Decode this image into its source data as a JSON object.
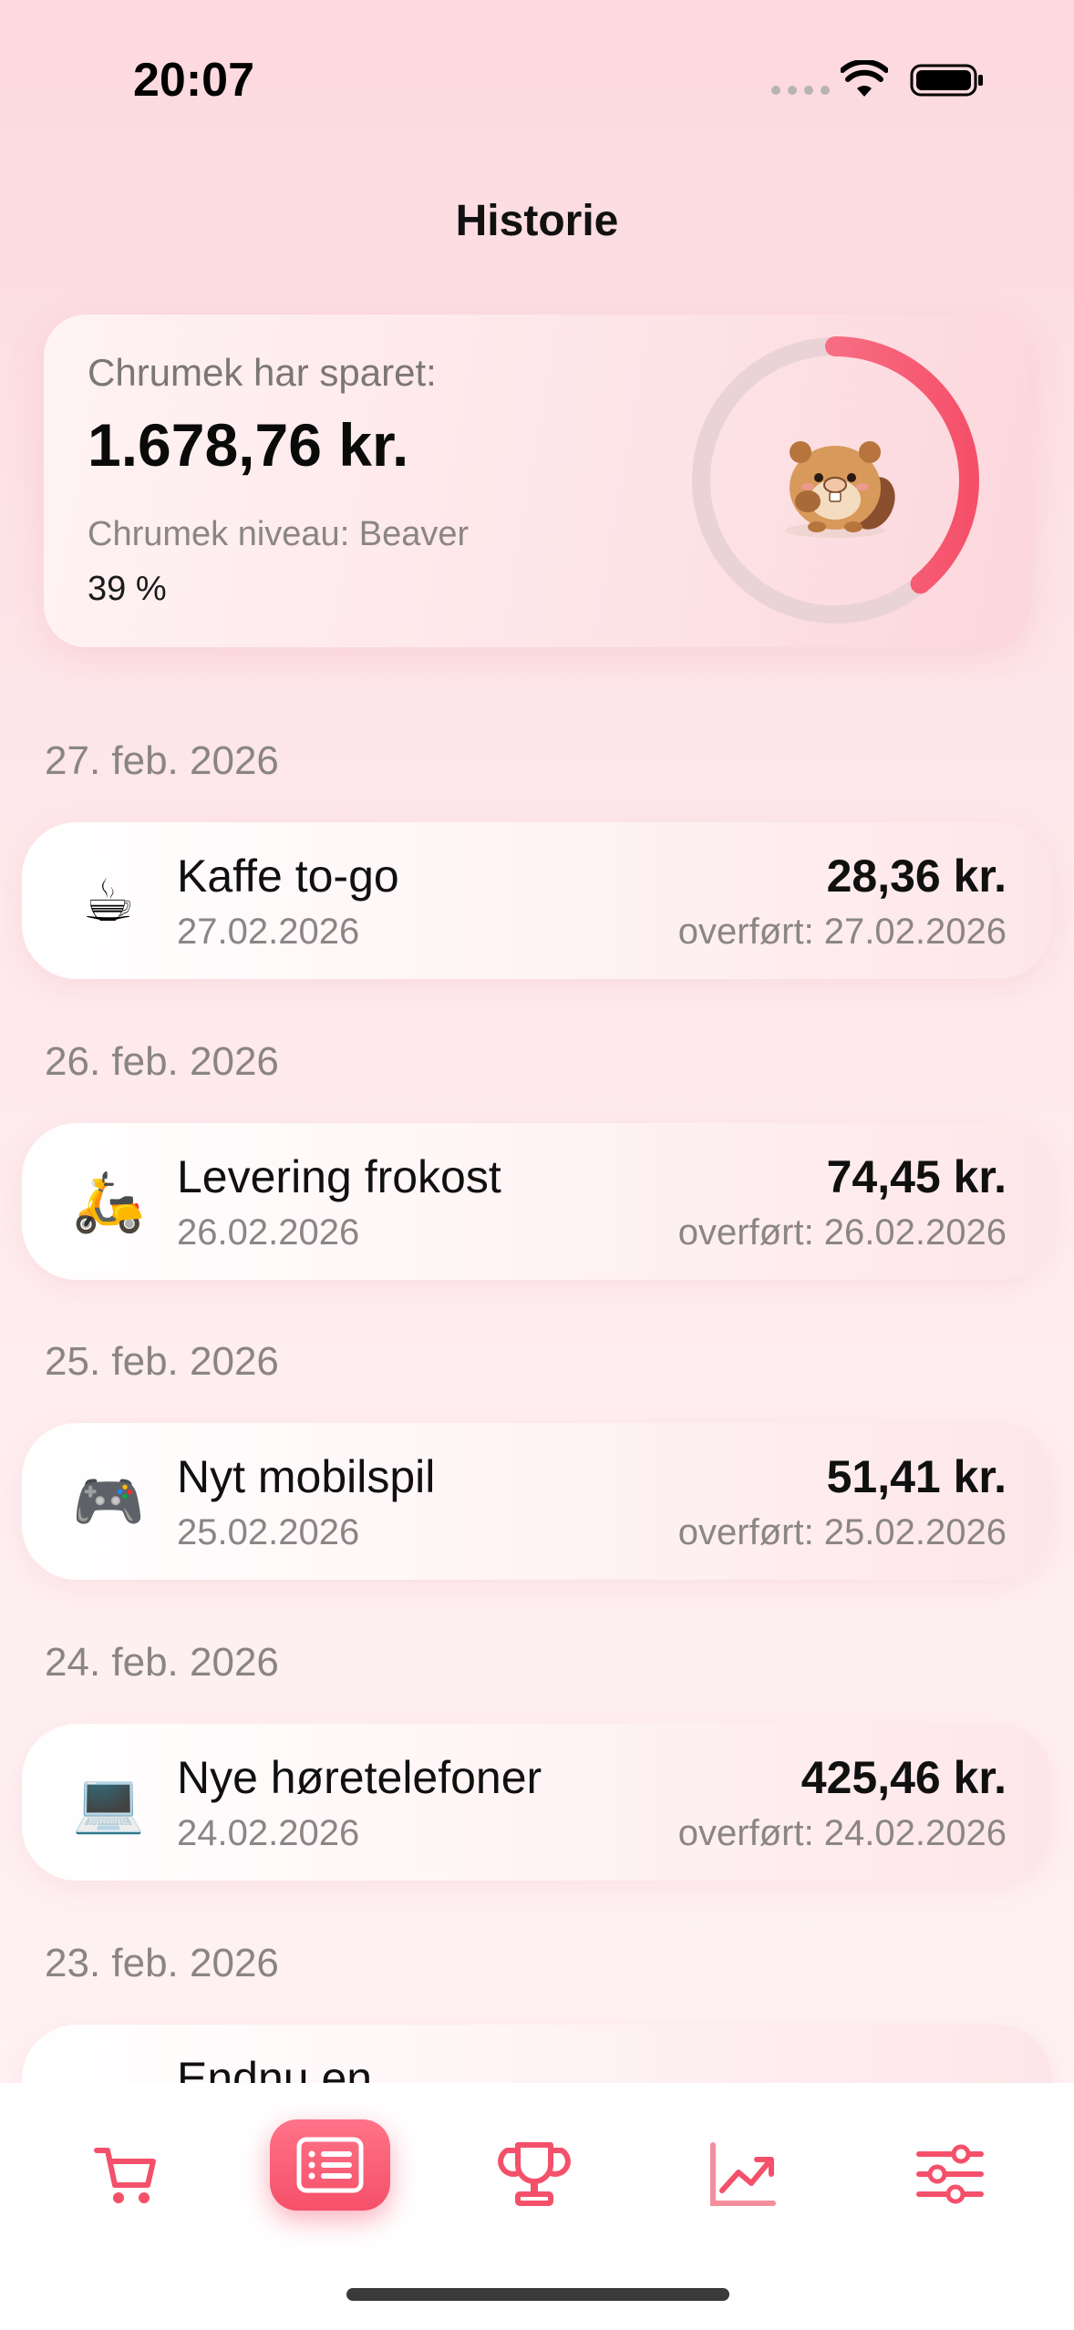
{
  "status": {
    "time": "20:07"
  },
  "header": {
    "title": "Historie"
  },
  "summary": {
    "saved_label": "Chrumek har sparet:",
    "saved_amount": "1.678,76 kr.",
    "level_label": "Chrumek niveau: Beaver",
    "level_percent": "39 %",
    "progress": 0.39,
    "mascot_icon": "beaver-mascot",
    "accent_color": "#f5506a"
  },
  "history": [
    {
      "day": "27. feb. 2026",
      "emoji": "☕",
      "icon": "coffee-icon",
      "title": "Kaffe to-go",
      "date": "27.02.2026",
      "amount": "28,36 kr.",
      "transferred": "overført: 27.02.2026"
    },
    {
      "day": "26. feb. 2026",
      "emoji": "🛵",
      "icon": "scooter-icon",
      "title": "Levering frokost",
      "date": "26.02.2026",
      "amount": "74,45 kr.",
      "transferred": "overført: 26.02.2026"
    },
    {
      "day": "25. feb. 2026",
      "emoji": "🎮",
      "icon": "gamepad-icon",
      "title": "Nyt mobilspil",
      "date": "25.02.2026",
      "amount": "51,41 kr.",
      "transferred": "overført: 25.02.2026"
    },
    {
      "day": "24. feb. 2026",
      "emoji": "💻",
      "icon": "laptop-icon",
      "title": "Nye høretelefoner",
      "date": "24.02.2026",
      "amount": "425,46 kr.",
      "transferred": "overført: 24.02.2026"
    },
    {
      "day": "23. feb. 2026",
      "title": "Endnu en"
    }
  ],
  "tabs": [
    {
      "icon": "cart-icon"
    },
    {
      "icon": "history-list-icon",
      "active": true
    },
    {
      "icon": "trophy-icon"
    },
    {
      "icon": "chart-trend-icon"
    },
    {
      "icon": "sliders-icon"
    }
  ]
}
